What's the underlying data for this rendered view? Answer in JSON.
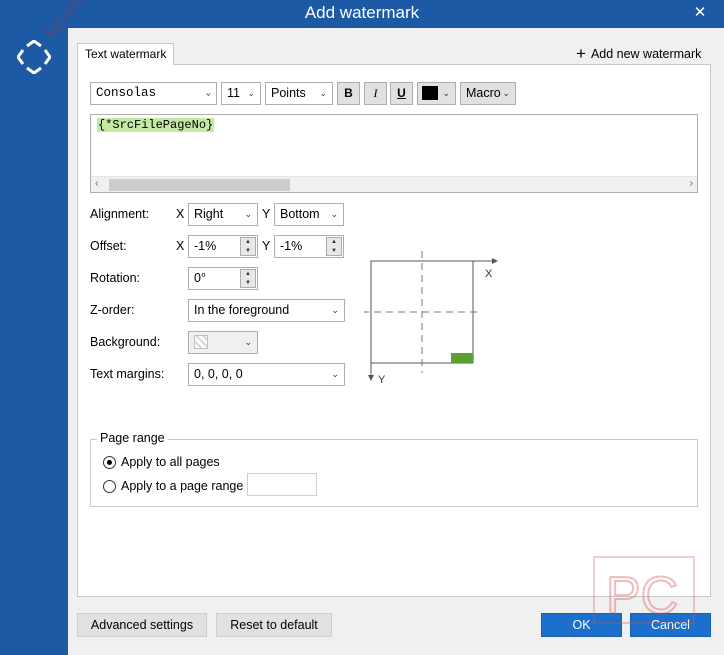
{
  "window": {
    "title": "Add watermark",
    "close_glyph": "✕"
  },
  "tabs": {
    "active": "Text watermark",
    "add_new": "Add new watermark"
  },
  "toolbar": {
    "font": "Consolas",
    "size": "11",
    "unit": "Points",
    "bold": "B",
    "italic": "I",
    "underline": "U",
    "color_hex": "#000000",
    "macro": "Macro"
  },
  "editor": {
    "text": "{*SrcFilePageNo}"
  },
  "alignment": {
    "label": "Alignment:",
    "x_label": "X",
    "x_value": "Right",
    "y_label": "Y",
    "y_value": "Bottom"
  },
  "offset": {
    "label": "Offset:",
    "x_label": "X",
    "x_value": "-1%",
    "y_label": "Y",
    "y_value": "-1%"
  },
  "rotation": {
    "label": "Rotation:",
    "value": "0°"
  },
  "zorder": {
    "label": "Z-order:",
    "value": "In the foreground"
  },
  "background": {
    "label": "Background:"
  },
  "text_margins": {
    "label": "Text margins:",
    "value": "0, 0, 0, 0"
  },
  "diagram": {
    "x_axis": "X",
    "y_axis": "Y",
    "marker_color": "#5ca133"
  },
  "page_range": {
    "legend": "Page range",
    "option_all": "Apply to all pages",
    "option_range": "Apply to a page range",
    "range_value": "",
    "selected": "all"
  },
  "footer": {
    "advanced": "Advanced settings",
    "reset": "Reset to default",
    "ok": "OK",
    "cancel": "Cancel"
  },
  "watermarks": {
    "overlay_text": "Winning PC",
    "overlay_pc": "PC"
  },
  "colors": {
    "title_bar": "#1c5aa5",
    "primary_button": "#1c6fcb",
    "highlight": "#c5e9a5"
  }
}
